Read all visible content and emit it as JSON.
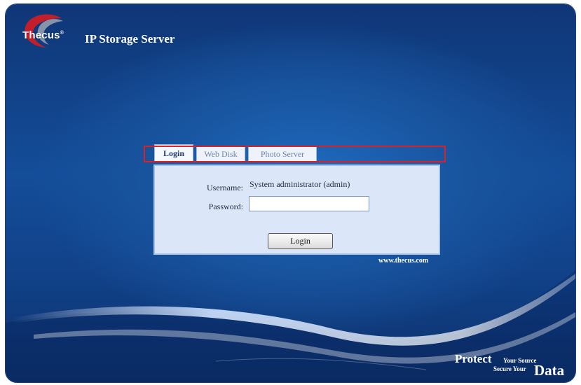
{
  "header": {
    "logo_text": "Thecus",
    "logo_mark": "®",
    "title": "IP Storage Server"
  },
  "tabs": [
    {
      "label": "Login",
      "active": true
    },
    {
      "label": "Web Disk",
      "active": false
    },
    {
      "label": "Photo Server",
      "active": false
    }
  ],
  "login_form": {
    "username_label": "Username:",
    "username_value": "System administrator (admin)",
    "password_label": "Password:",
    "password_value": "",
    "submit_label": "Login"
  },
  "footer": {
    "url": "www.thecus.com",
    "slogan_protect": "Protect",
    "slogan_your_source": "Your Source",
    "slogan_secure_your": "Secure Your",
    "slogan_data": "Data"
  },
  "colors": {
    "background": "#144d99",
    "panel": "#dbe6f8",
    "highlight": "#d8222a"
  },
  "icons": [
    "thecus-logo-swirl-icon"
  ]
}
